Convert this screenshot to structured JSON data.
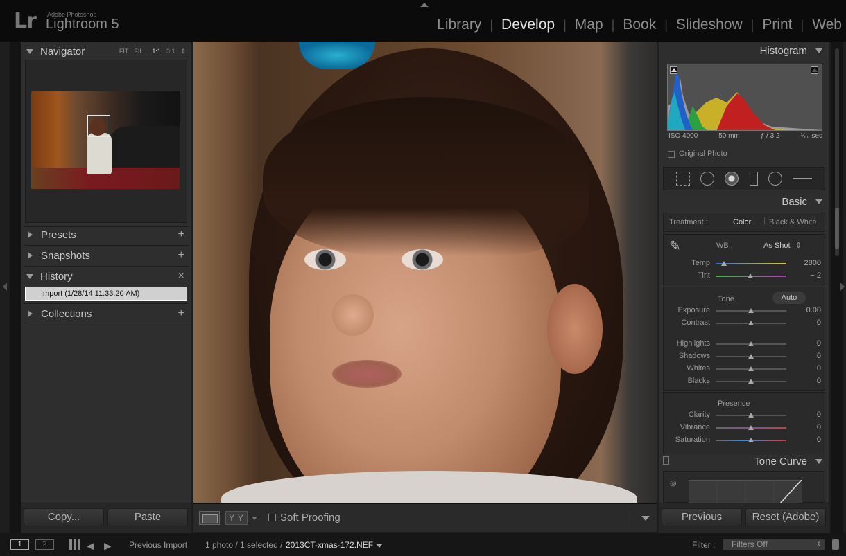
{
  "app": {
    "logo_mark": "Lr",
    "vendor": "Adobe Photoshop",
    "name": "Lightroom 5"
  },
  "modules": [
    "Library",
    "Develop",
    "Map",
    "Book",
    "Slideshow",
    "Print",
    "Web"
  ],
  "active_module": "Develop",
  "left_panel": {
    "navigator": {
      "title": "Navigator",
      "zoom_options": [
        "FIT",
        "FILL",
        "1:1",
        "3:1"
      ],
      "selected_zoom": "1:1"
    },
    "presets": {
      "title": "Presets",
      "action": "+"
    },
    "snapshots": {
      "title": "Snapshots",
      "action": "+"
    },
    "history": {
      "title": "History",
      "action": "×",
      "items": [
        "Import (1/28/14 11:33:20 AM)"
      ]
    },
    "collections": {
      "title": "Collections",
      "action": "+"
    },
    "copy_label": "Copy...",
    "paste_label": "Paste"
  },
  "toolbar": {
    "compare_label": "Y Y",
    "soft_proofing_label": "Soft Proofing",
    "soft_proofing_checked": false
  },
  "right_panel": {
    "histogram": {
      "title": "Histogram",
      "iso": "ISO 4000",
      "focal": "50 mm",
      "aperture": "ƒ / 3.2",
      "shutter": "¹⁄₆₀ sec",
      "original_photo_label": "Original Photo"
    },
    "basic": {
      "title": "Basic",
      "treatment_label": "Treatment :",
      "treatment_color": "Color",
      "treatment_bw": "Black & White",
      "wb_label": "WB :",
      "wb_value": "As Shot",
      "temp": {
        "label": "Temp",
        "value": "2800",
        "pos": 0.12
      },
      "tint": {
        "label": "Tint",
        "value": "− 2",
        "pos": 0.49
      },
      "tone_label": "Tone",
      "auto_label": "Auto",
      "exposure": {
        "label": "Exposure",
        "value": "0.00",
        "pos": 0.5
      },
      "contrast": {
        "label": "Contrast",
        "value": "0",
        "pos": 0.5
      },
      "highlights": {
        "label": "Highlights",
        "value": "0",
        "pos": 0.5
      },
      "shadows": {
        "label": "Shadows",
        "value": "0",
        "pos": 0.5
      },
      "whites": {
        "label": "Whites",
        "value": "0",
        "pos": 0.5
      },
      "blacks": {
        "label": "Blacks",
        "value": "0",
        "pos": 0.5
      },
      "presence_label": "Presence",
      "clarity": {
        "label": "Clarity",
        "value": "0",
        "pos": 0.5
      },
      "vibrance": {
        "label": "Vibrance",
        "value": "0",
        "pos": 0.5
      },
      "saturation": {
        "label": "Saturation",
        "value": "0",
        "pos": 0.5
      }
    },
    "tone_curve": {
      "title": "Tone Curve"
    },
    "previous_label": "Previous",
    "reset_label": "Reset (Adobe)"
  },
  "filmstrip": {
    "screen1": "1",
    "screen2": "2",
    "source": "Previous Import",
    "count": "1 photo / 1 selected /",
    "filename": "2013CT-xmas-172.NEF",
    "filter_label": "Filter :",
    "filter_value": "Filters Off"
  },
  "colors": {
    "active_module": "#e2e2e2",
    "panel_bg": "#2e2e2e",
    "top_bar": "#0b0b0b"
  }
}
